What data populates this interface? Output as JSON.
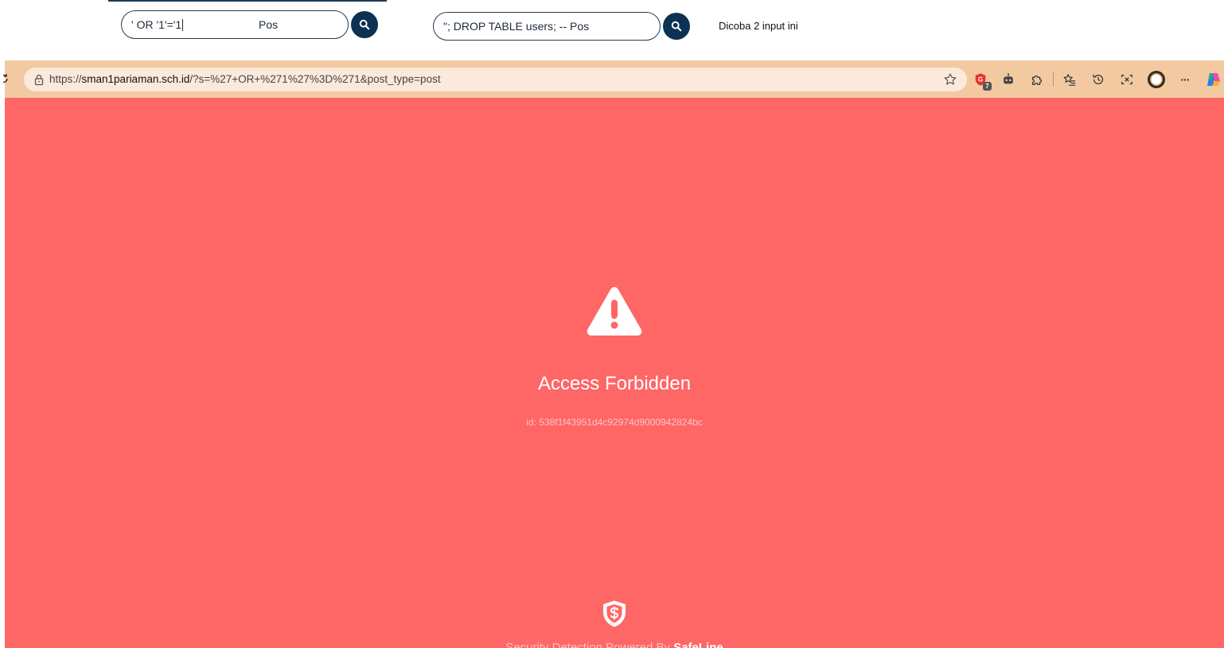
{
  "top_inputs": {
    "input1": {
      "value": "' OR '1'='1",
      "placeholder": "Pos"
    },
    "input2": {
      "value": "\"; DROP TABLE users; -- Pos"
    },
    "hint": "Dicoba 2 input ini"
  },
  "browser": {
    "url_scheme": "https://",
    "url_host": "sman1pariaman.sch.id",
    "url_path": "/?s=%27+OR+%271%27%3D%271&post_type=post",
    "badge_count": "7",
    "more_label": "···"
  },
  "page": {
    "title": "Access Forbidden",
    "request_id": "id: 538f1f43951d4c92974d9000942824bc",
    "powered_prefix": "Security Detection Powered By ",
    "powered_brand": "SafeLine"
  },
  "colors": {
    "page_background": "#ff6666",
    "toolbar_background": "#f3c9a2",
    "search_button": "#0c3152"
  },
  "icons": [
    "search-icon",
    "lock-icon",
    "star-icon",
    "shield-extension-icon",
    "robot-icon",
    "puzzle-icon",
    "favorites-icon",
    "history-icon",
    "screenshot-icon",
    "profile-icon",
    "more-icon",
    "copilot-icon",
    "warning-icon",
    "shield-logo"
  ]
}
